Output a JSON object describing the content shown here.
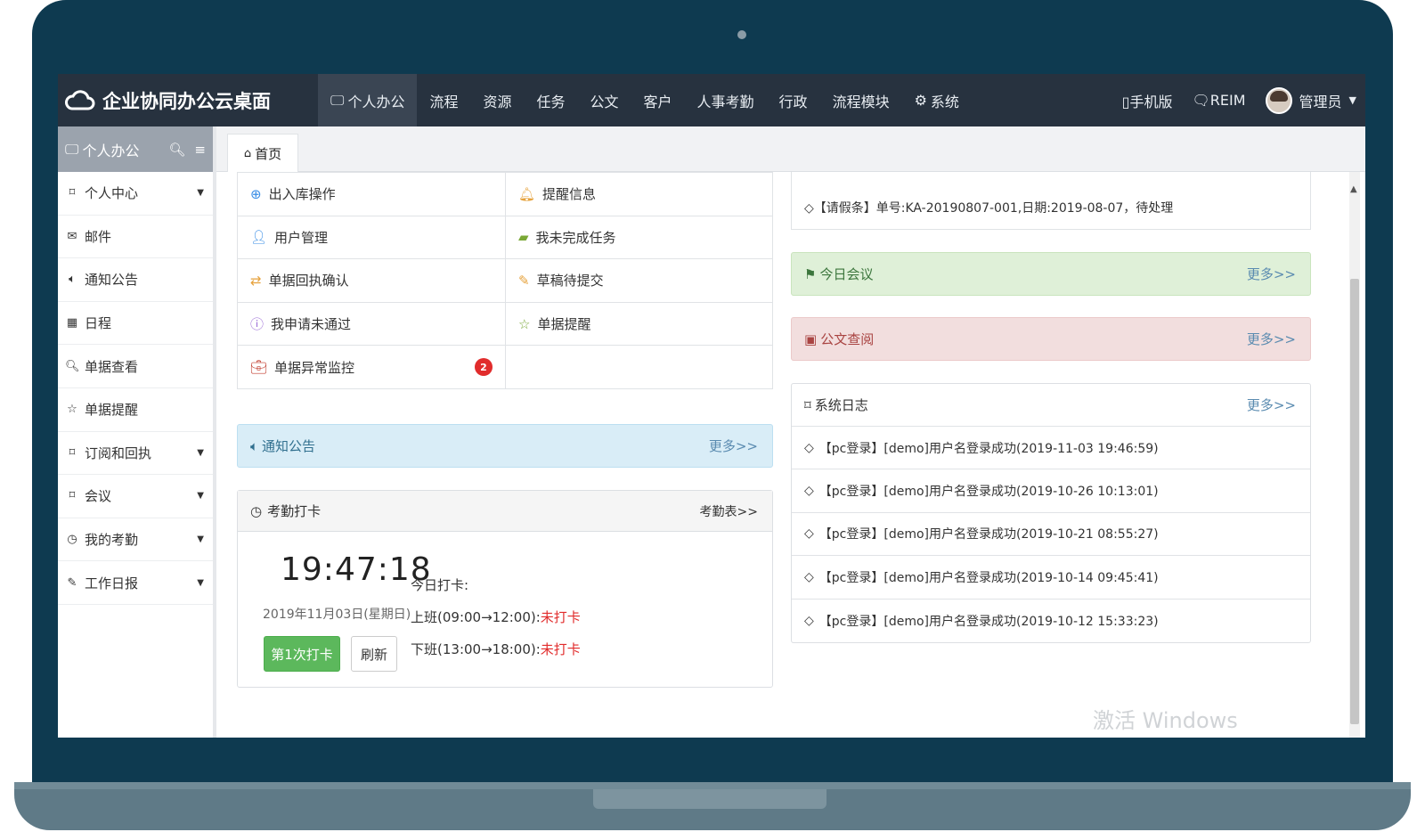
{
  "brand": {
    "title": "企业协同办公云桌面"
  },
  "nav": {
    "items": [
      {
        "label": "个人办公",
        "icon": "monitor-icon"
      },
      {
        "label": "流程"
      },
      {
        "label": "资源"
      },
      {
        "label": "任务"
      },
      {
        "label": "公文"
      },
      {
        "label": "客户"
      },
      {
        "label": "人事考勤"
      },
      {
        "label": "行政"
      },
      {
        "label": "流程模块"
      },
      {
        "label": "系统",
        "icon": "gear-icon"
      }
    ],
    "mobile": "手机版",
    "reim": "REIM",
    "user": "管理员"
  },
  "sidebar": {
    "title": "个人办公",
    "items": [
      {
        "label": "个人中心",
        "icon": "bookmark-icon",
        "caret": true
      },
      {
        "label": "邮件",
        "icon": "envelope-icon"
      },
      {
        "label": "通知公告",
        "icon": "volume-icon"
      },
      {
        "label": "日程",
        "icon": "calendar-icon"
      },
      {
        "label": "单据查看",
        "icon": "search-icon"
      },
      {
        "label": "单据提醒",
        "icon": "star-icon"
      },
      {
        "label": "订阅和回执",
        "icon": "bookmark-icon",
        "caret": true
      },
      {
        "label": "会议",
        "icon": "bookmark-icon",
        "caret": true
      },
      {
        "label": "我的考勤",
        "icon": "clock-icon",
        "caret": true
      },
      {
        "label": "工作日报",
        "icon": "edit-icon",
        "caret": true
      }
    ]
  },
  "tabs": {
    "home": "首页"
  },
  "quick": {
    "rows": [
      [
        {
          "label": "出入库操作"
        },
        {
          "label": "提醒信息"
        }
      ],
      [
        {
          "label": "用户管理"
        },
        {
          "label": "我未完成任务"
        }
      ],
      [
        {
          "label": "单据回执确认"
        },
        {
          "label": "草稿待提交"
        }
      ],
      [
        {
          "label": "我申请未通过"
        },
        {
          "label": "单据提醒"
        }
      ],
      [
        {
          "label": "单据异常监控",
          "badge": "2"
        },
        {
          "label": ""
        }
      ]
    ]
  },
  "notice": {
    "title": "通知公告",
    "more": "更多>>"
  },
  "attendance": {
    "title": "考勤打卡",
    "more": "考勤表>>",
    "time": "19:47:18",
    "date": "2019年11月03日(星期日)",
    "today_label": "今日打卡:",
    "on_duty": "上班(09:00→12:00):",
    "off_duty": "下班(13:00→18:00):",
    "status_on": "未打卡",
    "status_off": "未打卡",
    "punch_button": "第1次打卡",
    "refresh_button": "刷新"
  },
  "right": {
    "top_item": "◇【请假条】单号:KA-20190807-001,日期:2019-08-07，待处理",
    "meeting": {
      "title": "今日会议",
      "more": "更多>>"
    },
    "doc": {
      "title": "公文查阅",
      "more": "更多>>"
    },
    "log": {
      "title": "系统日志",
      "more": "更多>>",
      "rows": [
        "【pc登录】[demo]用户名登录成功(2019-11-03 19:46:59)",
        "【pc登录】[demo]用户名登录成功(2019-10-26 10:13:01)",
        "【pc登录】[demo]用户名登录成功(2019-10-21 08:55:27)",
        "【pc登录】[demo]用户名登录成功(2019-10-14 09:45:41)",
        "【pc登录】[demo]用户名登录成功(2019-10-12 15:33:23)"
      ]
    }
  },
  "watermark": "激活 Windows",
  "colors": {
    "topbar": "#27323f",
    "sidebar_head": "#9ba3ad",
    "success": "#5cb85c",
    "danger": "#e12c2c",
    "link": "#5a8bb0"
  }
}
